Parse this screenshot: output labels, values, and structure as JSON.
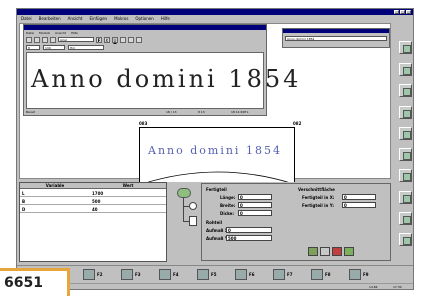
{
  "menu": [
    "Datei",
    "Bearbeiten",
    "Ansicht",
    "Einfügen",
    "Makros",
    "Optionen",
    "Hilfe"
  ],
  "subwin": {
    "menu": [
      "Datei",
      "Modulb",
      "Ansicht",
      "Hilfe"
    ],
    "font": "Arial",
    "size": "8",
    "width": "130",
    "spacing": "Hm",
    "preview_text": "Anno domini 1854",
    "status_left": "Bereit",
    "status_mid": "18 / 13",
    "status_mid2": "8 13",
    "status_right": "18 14 RDTL"
  },
  "right_dialog": {
    "field": "Anno domini 1854"
  },
  "canvas": {
    "corner_tl": "083",
    "corner_tr": "082",
    "corner_br": "081",
    "text": "Anno domini 1854"
  },
  "grid": {
    "headers": [
      "Variable",
      "Wert"
    ],
    "rows": [
      [
        "L",
        "1700"
      ],
      [
        "B",
        "500"
      ],
      [
        "D",
        "40"
      ]
    ]
  },
  "fertigteil": {
    "title": "Fertigteil",
    "fields": [
      {
        "label": "Länge:",
        "value": "0"
      },
      {
        "label": "Breite:",
        "value": "0"
      },
      {
        "label": "Dicke:",
        "value": "0"
      }
    ]
  },
  "rohteil": {
    "title": "Rohteil",
    "fields": [
      {
        "label": "Aufmaß X:",
        "value": "0"
      },
      {
        "label": "Aufmaß Y:",
        "value": "500"
      }
    ]
  },
  "verschiebung": {
    "title": "Verschnittfläche",
    "fields": [
      {
        "label": "Fertigteil in X:",
        "value": "0"
      },
      {
        "label": "Fertigteil in Y:",
        "value": "0"
      }
    ]
  },
  "fkeys": [
    "F1",
    "F2",
    "F3",
    "F4",
    "F5",
    "F6",
    "F7",
    "F8",
    "F9"
  ],
  "status": {
    "right1": "14,84",
    "right2": "17:34"
  },
  "figure_number": "6651"
}
